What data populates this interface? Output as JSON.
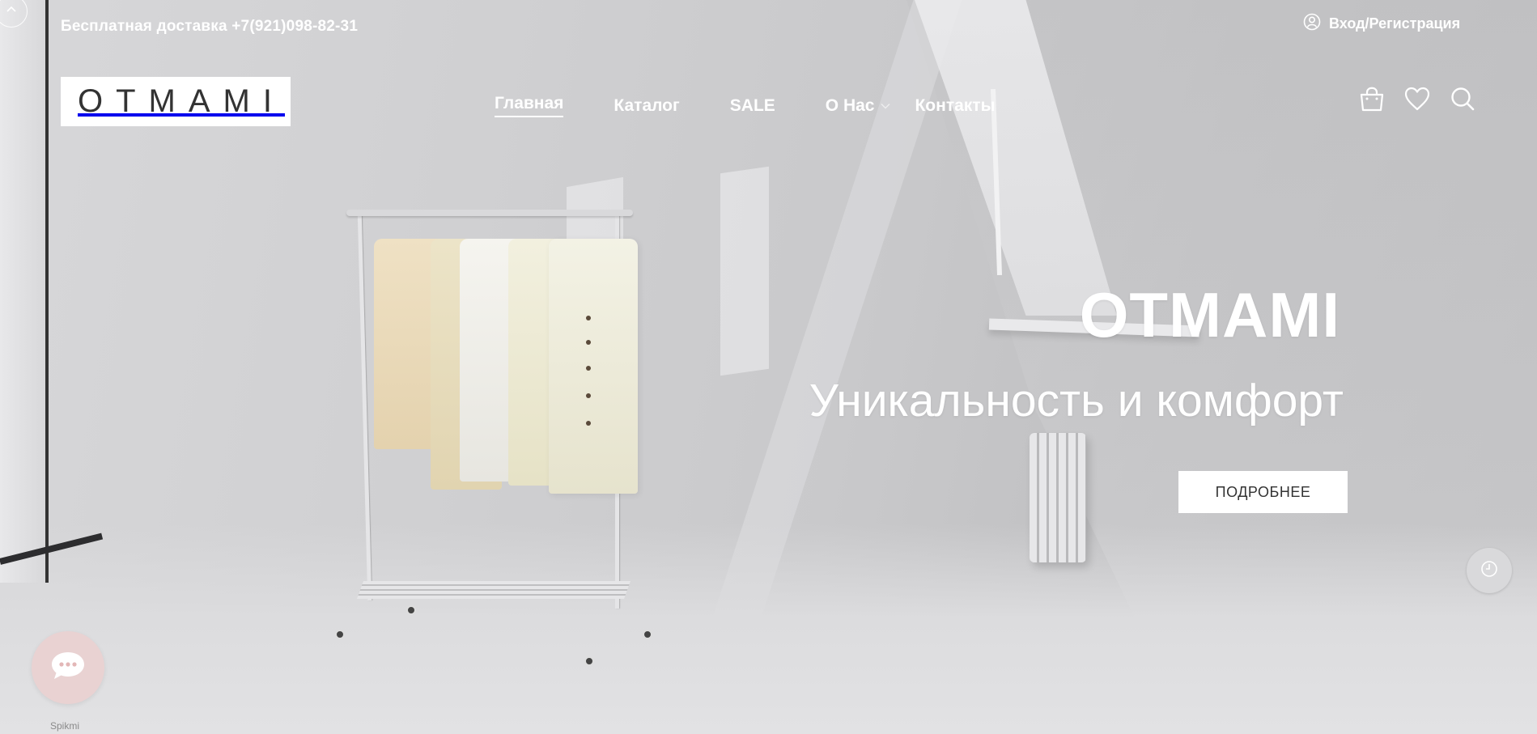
{
  "topbar": {
    "delivery_text": "Бесплатная доставка +7(921)098-82-31",
    "login_label": "Вход/Регистрация",
    "login_icon": "user-icon",
    "back_icon": "chevron-up-icon"
  },
  "header": {
    "logo_text": "OTMAMI",
    "nav": [
      {
        "label": "Главная",
        "active": true
      },
      {
        "label": "Каталог",
        "active": false
      },
      {
        "label": "SALE",
        "active": false
      },
      {
        "label": "О Нас",
        "active": false,
        "has_dropdown": true
      },
      {
        "label": "Контакты",
        "active": false
      }
    ],
    "icons": [
      "cart-bag-icon",
      "heart-icon",
      "search-icon"
    ]
  },
  "hero": {
    "title": "OTMAMI",
    "subtitle": "Уникальность и комфорт",
    "button_label": "ПОДРОБНЕЕ"
  },
  "widgets": {
    "clock_icon": "clock-icon",
    "chat_icon": "chat-bubble-icon",
    "chat_label": "Spikmi"
  },
  "colors": {
    "logo_text": "#333333",
    "chat_bg": "#e9d2d2",
    "clock_bg": "#d9d9db"
  }
}
